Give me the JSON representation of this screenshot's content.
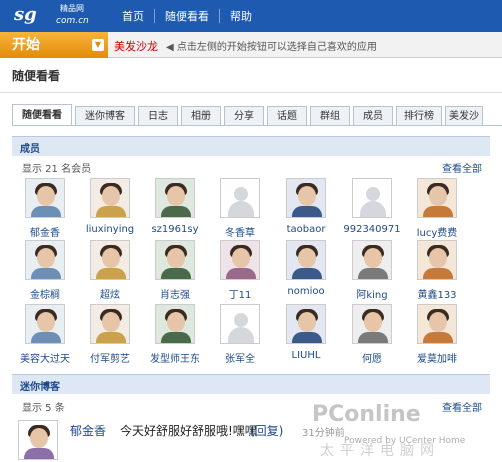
{
  "header": {
    "logo_text": "sg",
    "logo_sub": "精品网",
    "logo_domain": "com.cn",
    "nav": [
      "首页",
      "随便看看",
      "帮助"
    ]
  },
  "startbar": {
    "start_label": "开始",
    "app_name": "美发沙龙",
    "hint": "◀ 点击左侧的开始按钮可以选择自己喜欢的应用"
  },
  "page": {
    "title": "随便看看"
  },
  "tabs": [
    "随便看看",
    "迷你博客",
    "日志",
    "相册",
    "分享",
    "话题",
    "群组",
    "成员",
    "排行榜",
    "美发沙"
  ],
  "members_section": {
    "title": "成员",
    "count_text": "显示 21 名会员",
    "view_all": "查看全部",
    "members": [
      {
        "name": "郁金香",
        "avatar": "photo"
      },
      {
        "name": "liuxinying",
        "avatar": "photo"
      },
      {
        "name": "sz1961sy",
        "avatar": "photo"
      },
      {
        "name": "冬香草",
        "avatar": "placeholder"
      },
      {
        "name": "taobaor",
        "avatar": "photo"
      },
      {
        "name": "992340971",
        "avatar": "placeholder"
      },
      {
        "name": "lucy费费",
        "avatar": "photo"
      },
      {
        "name": "金棕榈",
        "avatar": "photo"
      },
      {
        "name": "超炫",
        "avatar": "photo"
      },
      {
        "name": "肖志强",
        "avatar": "photo"
      },
      {
        "name": "丁11",
        "avatar": "photo"
      },
      {
        "name": "nomioo",
        "avatar": "photo"
      },
      {
        "name": "阿king",
        "avatar": "photo"
      },
      {
        "name": "黄鑫133",
        "avatar": "photo"
      },
      {
        "name": "美容大过天",
        "avatar": "photo"
      },
      {
        "name": "付军剪艺",
        "avatar": "photo"
      },
      {
        "name": "发型师王东",
        "avatar": "photo"
      },
      {
        "name": "张军全",
        "avatar": "placeholder"
      },
      {
        "name": "LIUHL",
        "avatar": "photo"
      },
      {
        "name": "何愿",
        "avatar": "photo"
      },
      {
        "name": "爱莫加啡",
        "avatar": "photo"
      }
    ]
  },
  "blog_section": {
    "title": "迷你博客",
    "count_text": "显示 5 条",
    "view_all": "查看全部",
    "entry": {
      "user": "郁金香",
      "text": "今天好舒服好舒服哦!嘿嘿",
      "reply": "(回复)",
      "time": "31分钟前"
    }
  },
  "watermark": {
    "brand": "PConline",
    "powered": "Powered by UCenter Home",
    "cn": "太平洋电脑网"
  },
  "colors": {
    "header_blue": "#1e5bb0",
    "start_orange": "#e38b0a",
    "link_blue": "#1e4a8a",
    "section_bg": "#dde8f4"
  }
}
